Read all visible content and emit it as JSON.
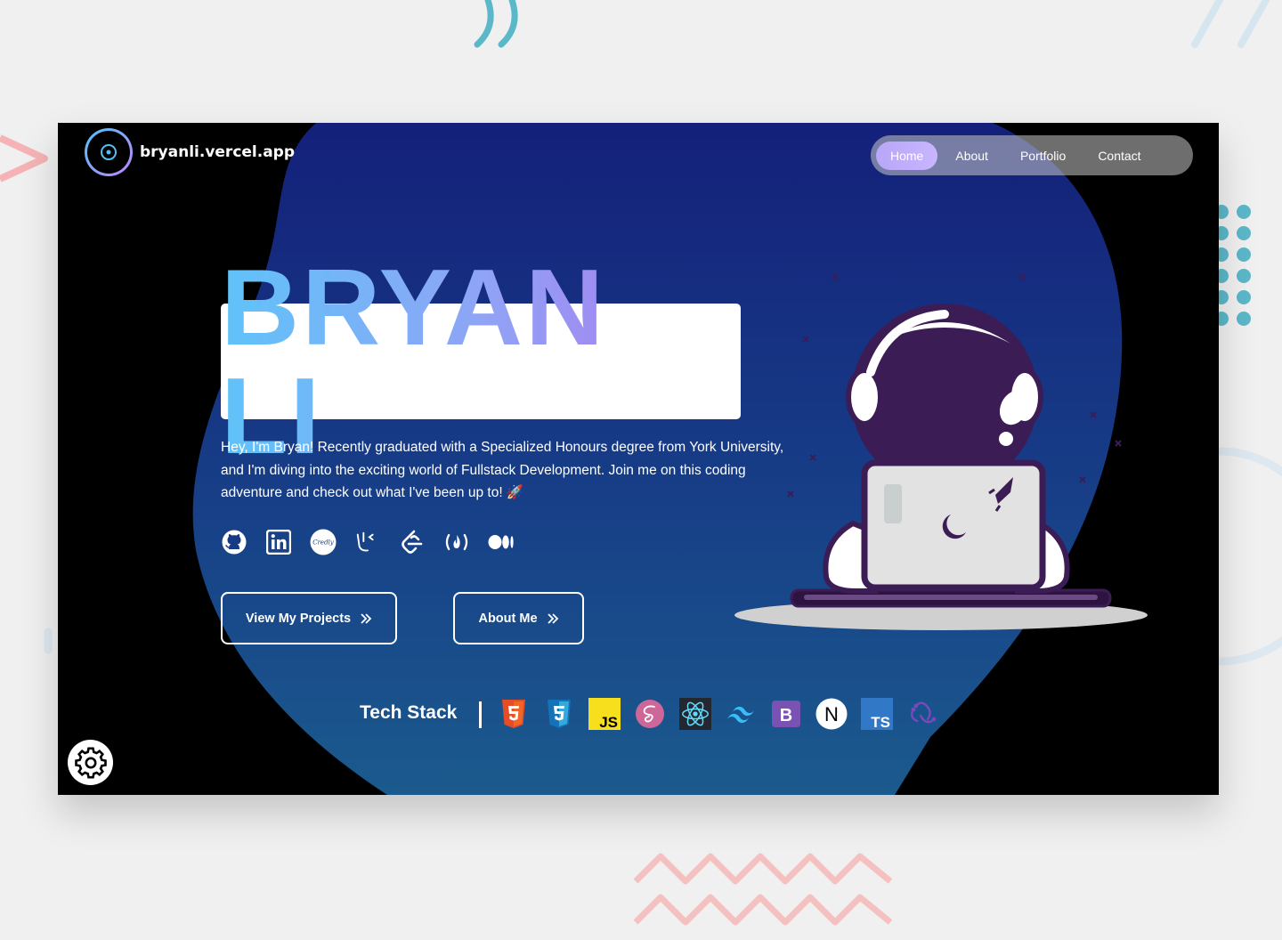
{
  "header": {
    "site_name": "bryanli.vercel.app"
  },
  "nav": {
    "items": [
      {
        "label": "Home",
        "active": true
      },
      {
        "label": "About",
        "active": false
      },
      {
        "label": "Portfolio",
        "active": false
      },
      {
        "label": "Contact",
        "active": false
      }
    ]
  },
  "hero": {
    "name": "BRYAN LI",
    "intro": "Hey, I'm Bryan! Recently graduated with a Specialized Honours degree from York University, and I'm diving into the exciting world of Fullstack Development. Join me on this coding adventure and check out what I've been up to! 🚀",
    "primary_button": "View My Projects",
    "secondary_button": "About Me"
  },
  "socials": [
    "github-icon",
    "linkedin-icon",
    "credly-icon",
    "kattis-icon",
    "leetcode-icon",
    "freecodecamp-icon",
    "medium-icon"
  ],
  "tech_stack": {
    "title": "Tech Stack",
    "icons": [
      "html5-icon",
      "css3-icon",
      "javascript-icon",
      "sass-icon",
      "react-icon",
      "tailwind-icon",
      "bootstrap-icon",
      "nextjs-icon",
      "typescript-icon",
      "redux-icon"
    ],
    "badges": {
      "js": "JS",
      "ts": "TS",
      "bootstrap": "B",
      "next": "N",
      "credly": "Credly"
    }
  },
  "colors": {
    "background": "#f0f0f0",
    "frame": "#000000",
    "blob_top": "#14217a",
    "blob_bottom": "#1a5a8e",
    "accent_gradient_start": "#5fc3f8",
    "accent_gradient_end": "#b072ee"
  }
}
